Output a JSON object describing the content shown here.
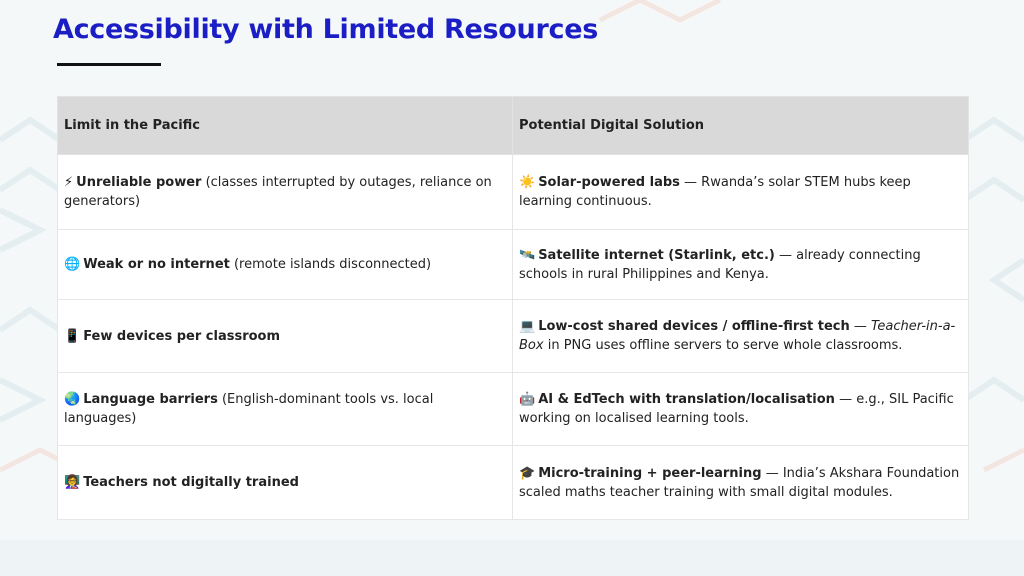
{
  "title": "Accessibility with Limited Resources",
  "columns": [
    "Limit in the Pacific",
    "Potential Digital Solution"
  ],
  "rows": [
    {
      "limit_icon": "⚡",
      "limit_bold": "Unreliable power",
      "limit_rest": " (classes interrupted by outages, reliance on generators)",
      "solution_icon": "☀️",
      "solution_bold": "Solar-powered labs",
      "solution_rest": " — Rwanda’s solar STEM hubs keep learning continuous."
    },
    {
      "limit_icon": "🌐",
      "limit_bold": "Weak or no internet",
      "limit_rest": " (remote islands disconnected)",
      "solution_icon": "🛰️",
      "solution_bold": "Satellite internet (Starlink, etc.)",
      "solution_rest": " — already connecting schools in rural Philippines and Kenya."
    },
    {
      "limit_icon": "📱",
      "limit_bold": "Few devices per classroom",
      "limit_rest": "",
      "solution_icon": "💻",
      "solution_bold": "Low-cost shared devices / offline-first tech",
      "solution_rest_pre": " — ",
      "solution_italic": "Teacher-in-a-Box",
      "solution_rest": " in PNG uses offline servers to serve whole classrooms."
    },
    {
      "limit_icon": "🌏",
      "limit_bold": "Language barriers",
      "limit_rest": " (English-dominant tools vs. local languages)",
      "solution_icon": "🤖",
      "solution_bold": "AI & EdTech with translation/localisation",
      "solution_rest": " — e.g., SIL Pacific working on localised learning tools."
    },
    {
      "limit_icon": "👩‍🏫",
      "limit_bold": "Teachers not digitally trained",
      "limit_rest": "",
      "solution_icon": "🎓",
      "solution_bold": "Micro-training + peer-learning",
      "solution_rest": " — India’s Akshara Foundation scaled maths teacher training with small digital modules."
    }
  ]
}
